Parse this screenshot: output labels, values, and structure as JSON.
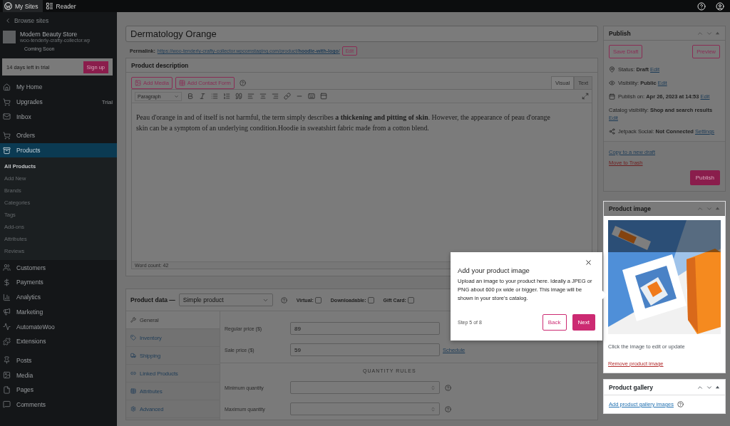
{
  "top_bar": {
    "items": [
      {
        "label": "My Sites",
        "selected": true
      },
      {
        "label": "Reader",
        "selected": false
      }
    ]
  },
  "sidebar": {
    "back": "Browse sites",
    "site_name": "Modern Beauty Store",
    "site_url": "woo-tenderly-crafty-collector.wp",
    "site_status": "Coming Soon",
    "trial": {
      "text": "14 days left in trial",
      "button": "Sign up"
    },
    "groups": [
      [
        {
          "label": "My Home",
          "selected": false
        },
        {
          "label": "Upgrades",
          "badge": "Trial",
          "selected": false
        },
        {
          "label": "Inbox",
          "selected": false
        }
      ],
      [
        {
          "label": "Orders",
          "selected": false
        },
        {
          "label": "Products",
          "selected": true,
          "children": [
            {
              "label": "All Products",
              "selected": true
            },
            {
              "label": "Add New",
              "selected": false
            },
            {
              "label": "Brands",
              "selected": false
            },
            {
              "label": "Categories",
              "selected": false
            },
            {
              "label": "Tags",
              "selected": false
            },
            {
              "label": "Add-ons",
              "selected": false
            },
            {
              "label": "Attributes",
              "selected": false
            },
            {
              "label": "Reviews",
              "selected": false
            }
          ]
        },
        {
          "label": "Customers",
          "selected": false
        },
        {
          "label": "Payments",
          "selected": false
        },
        {
          "label": "Analytics",
          "selected": false
        },
        {
          "label": "Marketing",
          "selected": false
        },
        {
          "label": "AutomateWoo",
          "selected": false
        },
        {
          "label": "Extensions",
          "selected": false
        }
      ],
      [
        {
          "label": "Posts",
          "selected": false
        },
        {
          "label": "Media",
          "selected": false
        },
        {
          "label": "Pages",
          "selected": false
        },
        {
          "label": "Comments",
          "selected": false
        }
      ]
    ]
  },
  "editor": {
    "title": "Dermatology Orange",
    "permalink_label": "Permalink:",
    "permalink": "https://woo-tenderly-crafty-collector.wpcomstaging.com/product/**hoodie-with-logo**/",
    "permalink_button": "Edit",
    "description": {
      "title": "Product description",
      "buttons": [
        "Add Media",
        "Add Contact Form"
      ],
      "tabs": [
        {
          "label": "Visual",
          "selected": true
        },
        {
          "label": "Text",
          "selected": false
        }
      ],
      "format": "Paragraph",
      "content": "Peau d'orange in and of itself is not harmful, the term simply describes **a thickening and pitting of skin**. However, the appearance of peau d'orange skin can be a symptom of an underlying condition.Hoodie in sweatshirt fabric made from a cotton blend.",
      "word_count": "Word count: 42"
    },
    "product_data": {
      "title": "Product data —",
      "type": "Simple product",
      "checkboxes": [
        {
          "label": "Virtual:",
          "checked": false
        },
        {
          "label": "Downloadable:",
          "checked": false
        },
        {
          "label": "Gift Card:",
          "checked": false
        }
      ],
      "tabs": [
        {
          "label": "General",
          "selected": true
        },
        {
          "label": "Inventory",
          "selected": false
        },
        {
          "label": "Shipping",
          "selected": false
        },
        {
          "label": "Linked Products",
          "selected": false
        },
        {
          "label": "Attributes",
          "selected": false
        },
        {
          "label": "Advanced",
          "selected": false
        }
      ],
      "prices": [
        {
          "label": "Regular price ($)",
          "value": "89"
        },
        {
          "label": "Sale price ($)",
          "value": "59",
          "link": "Schedule"
        }
      ],
      "section": "QUANTITY RULES",
      "quantities": [
        {
          "label": "Minimum quantity"
        },
        {
          "label": "Maximum quantity"
        }
      ]
    }
  },
  "publish": {
    "title": "Publish",
    "save_draft": "Save Draft",
    "preview": "Preview",
    "rows": [
      {
        "label": "Status:",
        "value": "Draft",
        "link": "Edit"
      },
      {
        "label": "Visibility:",
        "value": "Public",
        "link": "Edit"
      },
      {
        "label": "Publish on:",
        "value": "Apr 26, 2023 at 14:53",
        "link": "Edit"
      },
      {
        "label": "Catalog visibility:",
        "value": "Shop and search results",
        "link": "Edit"
      },
      {
        "label": "Jetpack Social:",
        "value": "Not Connected",
        "link": "Settings"
      }
    ],
    "copy_link": "Copy to a new draft",
    "trash_link": "Move to Trash",
    "button": "Publish"
  },
  "product_image": {
    "title": "Product image",
    "hint": "Click the image to edit or update",
    "remove": "Remove product image"
  },
  "gallery": {
    "title": "Product gallery",
    "link": "Add product gallery images"
  },
  "tour": {
    "title": "Add your product image",
    "body": "Upload an image to your product here. Ideally a JPEG or PNG about 600 px wide or bigger. This image will be shown in your store's catalog.",
    "step": "Step 5 of 8",
    "back": "Back",
    "next": "Next"
  }
}
